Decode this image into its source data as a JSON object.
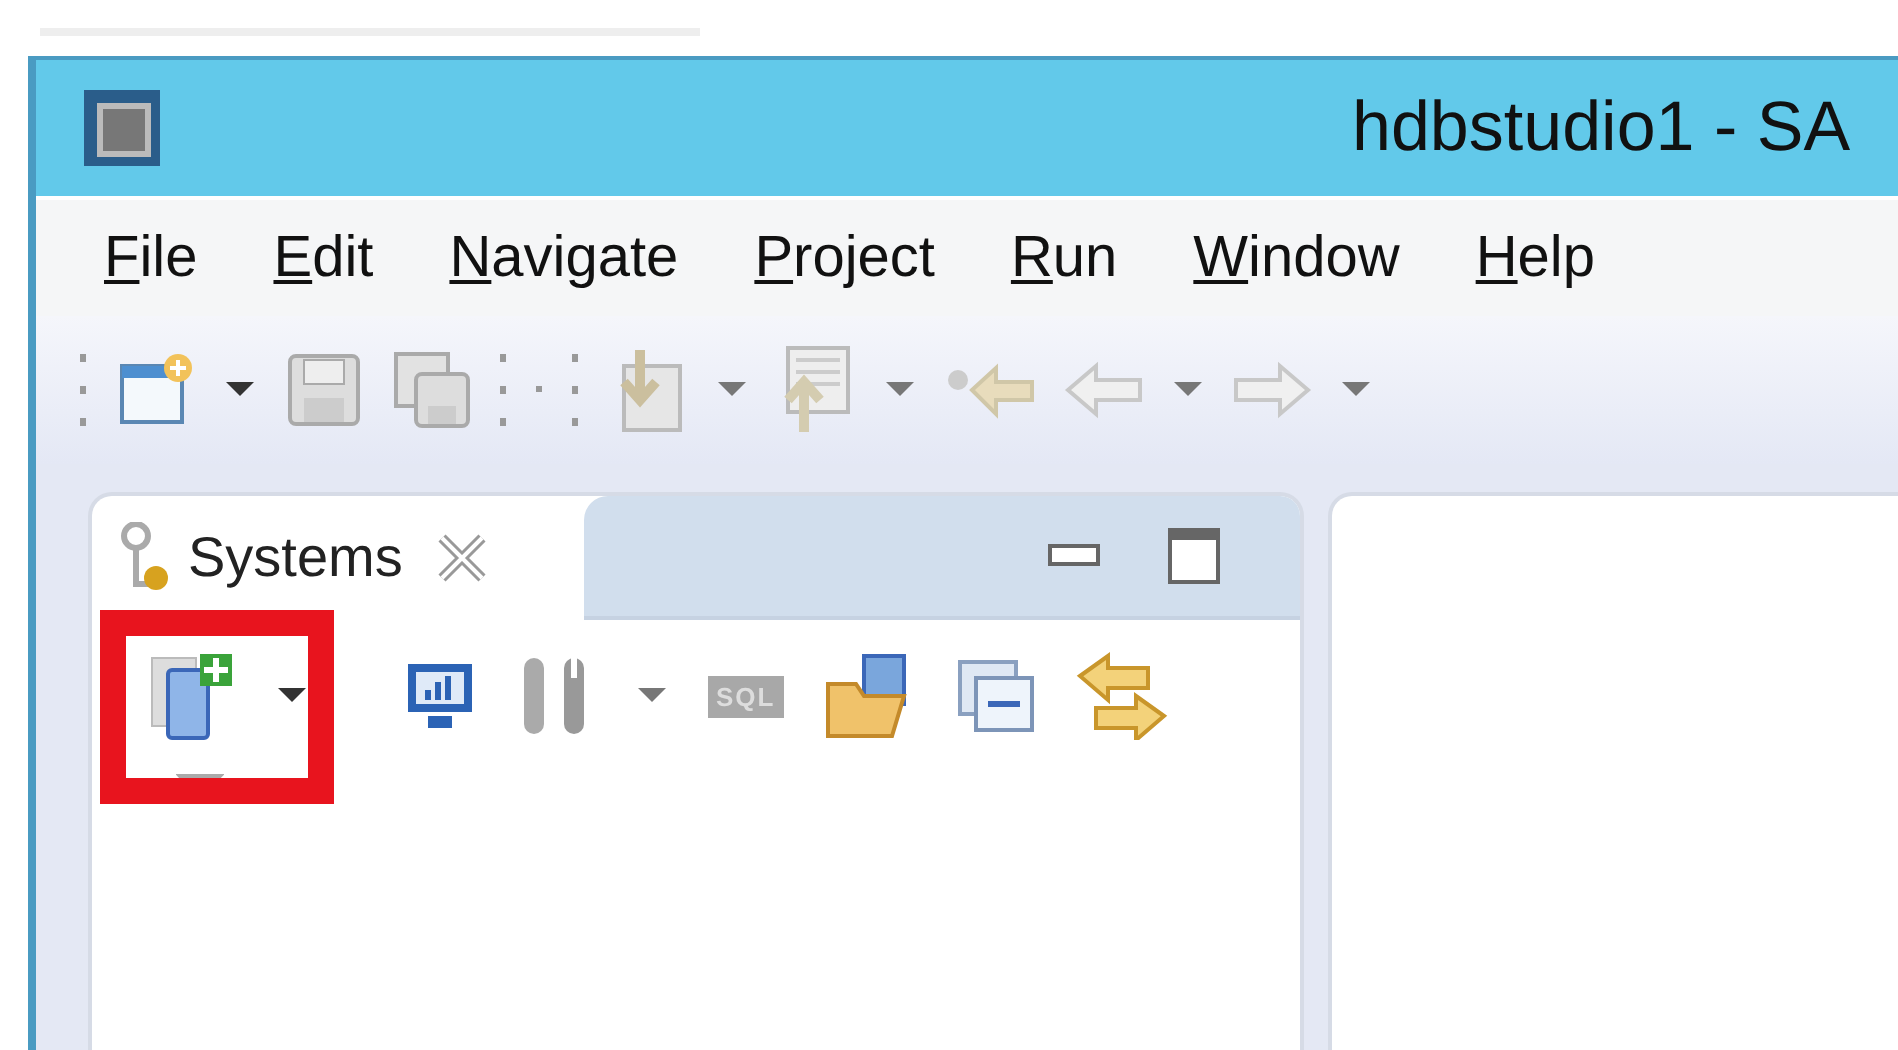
{
  "window": {
    "title": "hdbstudio1 - SA"
  },
  "menu": [
    {
      "label": "File"
    },
    {
      "label": "Edit"
    },
    {
      "label": "Navigate"
    },
    {
      "label": "Project"
    },
    {
      "label": "Run"
    },
    {
      "label": "Window"
    },
    {
      "label": "Help"
    }
  ],
  "panel": {
    "tab": {
      "label": "Systems",
      "selected": true
    },
    "sql_label": "SQL"
  }
}
